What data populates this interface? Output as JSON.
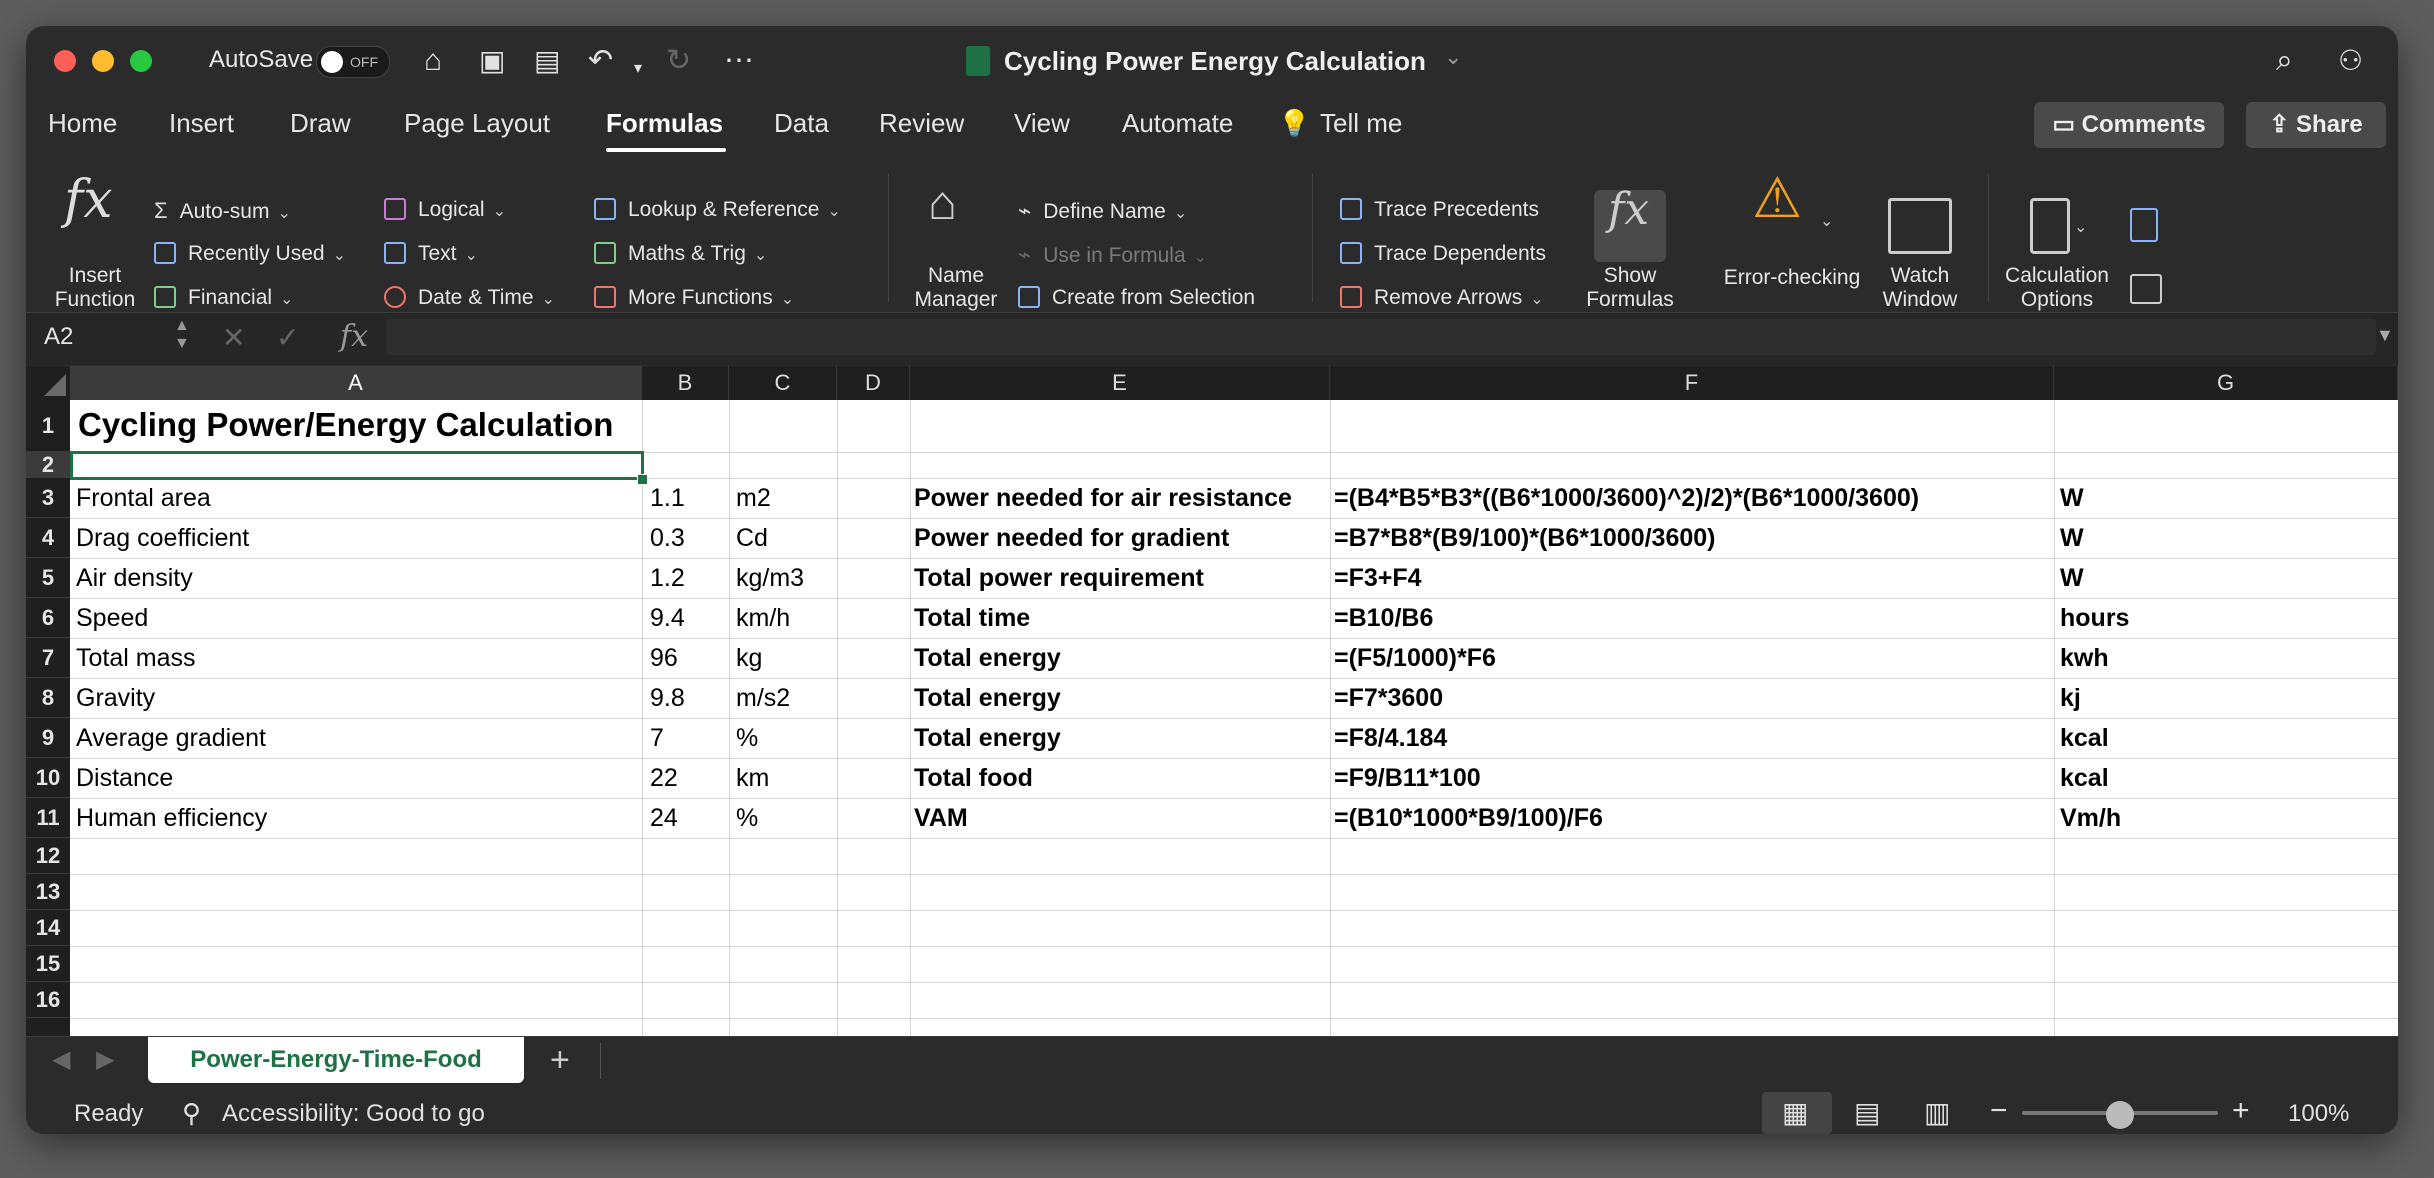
{
  "window": {
    "autosave_label": "AutoSave",
    "autosave_state": "OFF",
    "title": "Cycling Power Energy Calculation"
  },
  "tabs": [
    "Home",
    "Insert",
    "Draw",
    "Page Layout",
    "Formulas",
    "Data",
    "Review",
    "View",
    "Automate",
    "Tell me"
  ],
  "active_tab": "Formulas",
  "header_buttons": {
    "comments": "Comments",
    "share": "Share"
  },
  "ribbon": {
    "insert_function": [
      "Insert",
      "Function"
    ],
    "autosum": "Auto-sum",
    "recently_used": "Recently Used",
    "financial": "Financial",
    "logical": "Logical",
    "text": "Text",
    "date_time": "Date & Time",
    "lookup": "Lookup & Reference",
    "maths": "Maths & Trig",
    "more_functions": "More Functions",
    "name_manager": [
      "Name",
      "Manager"
    ],
    "define_name": "Define Name",
    "use_in_formula": "Use in Formula",
    "create_from_selection": "Create from Selection",
    "trace_precedents": "Trace Precedents",
    "trace_dependents": "Trace Dependents",
    "remove_arrows": "Remove Arrows",
    "show_formulas": [
      "Show",
      "Formulas"
    ],
    "error_checking": "Error-checking",
    "watch_window": [
      "Watch",
      "Window"
    ],
    "calc_options": [
      "Calculation",
      "Options"
    ]
  },
  "formula_bar": {
    "name_box": "A2",
    "fx": "fx",
    "formula": ""
  },
  "columns": [
    "A",
    "B",
    "C",
    "D",
    "E",
    "F",
    "G"
  ],
  "rows": [
    "1",
    "2",
    "3",
    "4",
    "5",
    "6",
    "7",
    "8",
    "9",
    "10",
    "11",
    "12",
    "13",
    "14",
    "15",
    "16"
  ],
  "cells": {
    "title": "Cycling Power/Energy Calculation",
    "inputs": [
      {
        "label": "Frontal area",
        "value": "1.1",
        "unit": "m2"
      },
      {
        "label": "Drag coefficient",
        "value": "0.3",
        "unit": "Cd"
      },
      {
        "label": "Air density",
        "value": "1.2",
        "unit": "kg/m3"
      },
      {
        "label": "Speed",
        "value": "9.4",
        "unit": "km/h"
      },
      {
        "label": "Total mass",
        "value": "96",
        "unit": "kg"
      },
      {
        "label": "Gravity",
        "value": "9.8",
        "unit": "m/s2"
      },
      {
        "label": "Average gradient",
        "value": "7",
        "unit": "%"
      },
      {
        "label": "Distance",
        "value": "22",
        "unit": "km"
      },
      {
        "label": "Human efficiency",
        "value": "24",
        "unit": "%"
      }
    ],
    "outputs": [
      {
        "label": "Power needed for air resistance",
        "formula": "=(B4*B5*B3*((B6*1000/3600)^2)/2)*(B6*1000/3600)",
        "unit": "W"
      },
      {
        "label": "Power needed for gradient",
        "formula": "=B7*B8*(B9/100)*(B6*1000/3600)",
        "unit": "W"
      },
      {
        "label": "Total power requirement",
        "formula": "=F3+F4",
        "unit": "W"
      },
      {
        "label": "Total time",
        "formula": "=B10/B6",
        "unit": "hours"
      },
      {
        "label": "Total energy",
        "formula": "=(F5/1000)*F6",
        "unit": "kwh"
      },
      {
        "label": "Total energy",
        "formula": "=F7*3600",
        "unit": "kj"
      },
      {
        "label": "Total energy",
        "formula": "=F8/4.184",
        "unit": "kcal"
      },
      {
        "label": "Total food",
        "formula": "=F9/B11*100",
        "unit": "kcal"
      },
      {
        "label": "VAM",
        "formula": "=(B10*1000*B9/100)/F6",
        "unit": "Vm/h"
      }
    ]
  },
  "sheet_tab": "Power-Energy-Time-Food",
  "status": {
    "ready": "Ready",
    "accessibility": "Accessibility: Good to go",
    "zoom": "100%",
    "zoom_level": 0.5
  }
}
